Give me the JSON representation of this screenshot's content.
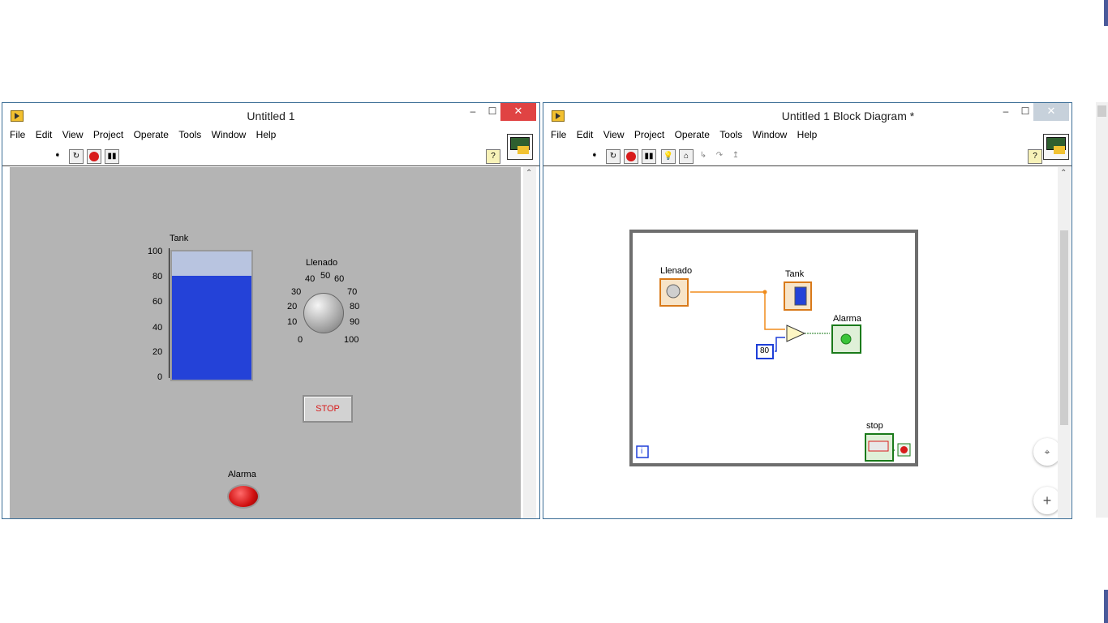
{
  "front_panel": {
    "title": "Untitled 1",
    "menu": [
      "File",
      "Edit",
      "View",
      "Project",
      "Operate",
      "Tools",
      "Window",
      "Help"
    ],
    "tank": {
      "label": "Tank",
      "fill_percent": 81,
      "scale": [
        "100",
        "80",
        "60",
        "40",
        "20",
        "0"
      ]
    },
    "knob": {
      "label": "Llenado",
      "scale": [
        "0",
        "10",
        "20",
        "30",
        "40",
        "50",
        "60",
        "70",
        "80",
        "90",
        "100"
      ]
    },
    "stop_button": "STOP",
    "led": {
      "label": "Alarma",
      "color": "#e02020"
    },
    "colors": {
      "tank_fill": "#2442d8",
      "panel_bg": "#b4b4b4"
    }
  },
  "block_diagram": {
    "title": "Untitled 1 Block Diagram *",
    "menu": [
      "File",
      "Edit",
      "View",
      "Project",
      "Operate",
      "Tools",
      "Window",
      "Help"
    ],
    "nodes": {
      "llenado": "Llenado",
      "tank": "Tank",
      "alarma": "Alarma",
      "stop": "stop",
      "constant": "80",
      "iteration": "i"
    },
    "colors": {
      "wire_double": "#f08c1c",
      "wire_bool": "#1a7a1a",
      "wire_int": "#1e3ed8"
    }
  },
  "controls": {
    "close": "✕",
    "minimize": "‒",
    "maximize": "☐"
  },
  "zoom": {
    "shrink": "⌖",
    "plus": "+"
  }
}
